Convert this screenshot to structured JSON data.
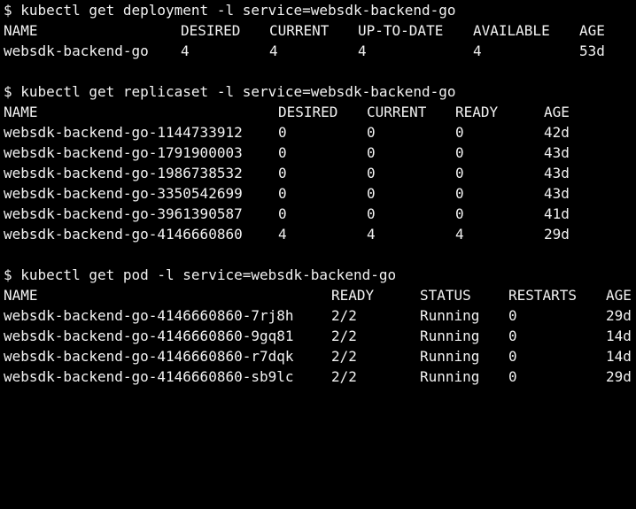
{
  "deployment": {
    "command": "$ kubectl get deployment -l service=websdk-backend-go",
    "headers": [
      "NAME",
      "DESIRED",
      "CURRENT",
      "UP-TO-DATE",
      "AVAILABLE",
      "AGE"
    ],
    "rows": [
      [
        "websdk-backend-go",
        "4",
        "4",
        "4",
        "4",
        "53d"
      ]
    ]
  },
  "replicaset": {
    "command": "$ kubectl get replicaset -l service=websdk-backend-go",
    "headers": [
      "NAME",
      "DESIRED",
      "CURRENT",
      "READY",
      "AGE"
    ],
    "rows": [
      [
        "websdk-backend-go-1144733912",
        "0",
        "0",
        "0",
        "42d"
      ],
      [
        "websdk-backend-go-1791900003",
        "0",
        "0",
        "0",
        "43d"
      ],
      [
        "websdk-backend-go-1986738532",
        "0",
        "0",
        "0",
        "43d"
      ],
      [
        "websdk-backend-go-3350542699",
        "0",
        "0",
        "0",
        "43d"
      ],
      [
        "websdk-backend-go-3961390587",
        "0",
        "0",
        "0",
        "41d"
      ],
      [
        "websdk-backend-go-4146660860",
        "4",
        "4",
        "4",
        "29d"
      ]
    ]
  },
  "pod": {
    "command": "$ kubectl get pod -l service=websdk-backend-go",
    "headers": [
      "NAME",
      "READY",
      "STATUS",
      "RESTARTS",
      "AGE"
    ],
    "rows": [
      [
        "websdk-backend-go-4146660860-7rj8h",
        "2/2",
        "Running",
        "0",
        "29d"
      ],
      [
        "websdk-backend-go-4146660860-9gq81",
        "2/2",
        "Running",
        "0",
        "14d"
      ],
      [
        "websdk-backend-go-4146660860-r7dqk",
        "2/2",
        "Running",
        "0",
        "14d"
      ],
      [
        "websdk-backend-go-4146660860-sb9lc",
        "2/2",
        "Running",
        "0",
        "29d"
      ]
    ]
  }
}
